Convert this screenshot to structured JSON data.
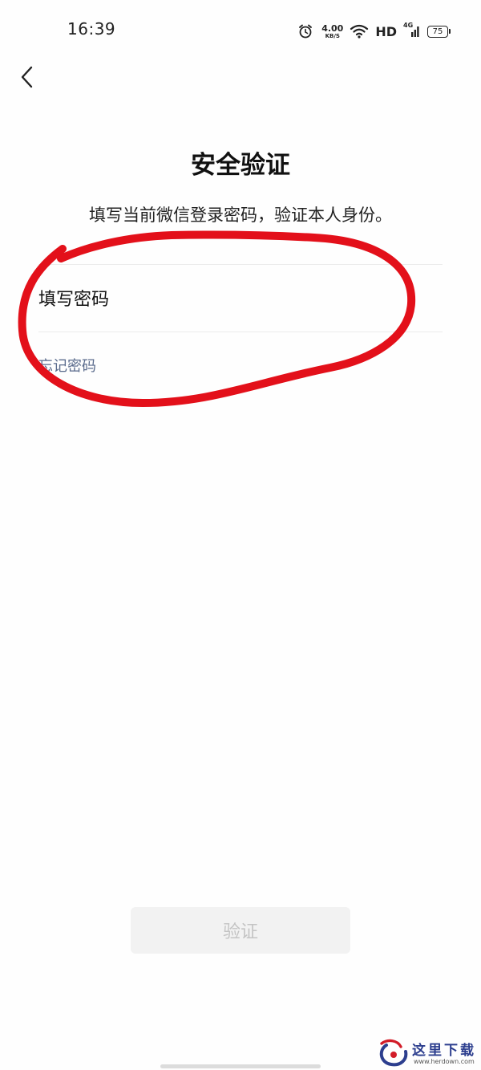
{
  "status_bar": {
    "time": "16:39",
    "net_speed_value": "4.00",
    "net_speed_unit": "KB/S",
    "hd_label": "HD",
    "network_type": "4G",
    "battery_level": "75",
    "icons": [
      "alarm-icon",
      "wifi-icon",
      "signal-icon",
      "battery-icon"
    ]
  },
  "nav": {
    "back_icon": "chevron-left-icon"
  },
  "main": {
    "title": "安全验证",
    "subtitle": "填写当前微信登录密码，验证本人身份。",
    "password_placeholder": "填写密码",
    "forgot_password": "忘记密码"
  },
  "footer": {
    "verify_label": "验证"
  },
  "watermark": {
    "text": "这里下载",
    "url": "www.herdown.com"
  },
  "colors": {
    "annotation": "#e3101a",
    "link": "#5a6b8c",
    "button_bg": "#f2f2f2",
    "button_text": "#c4c4c4"
  }
}
